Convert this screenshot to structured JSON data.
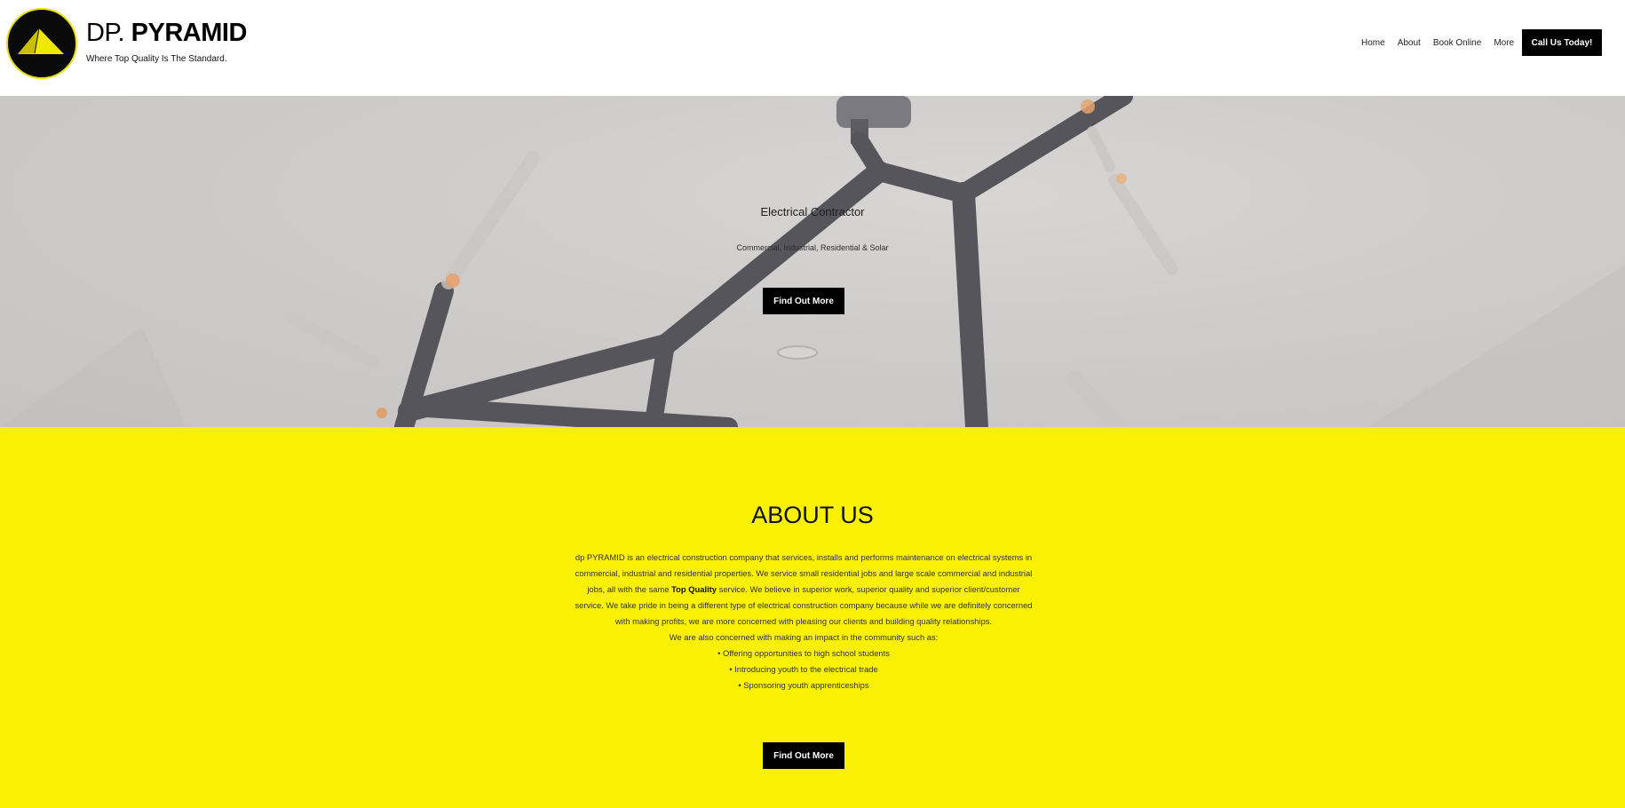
{
  "header": {
    "brand_prefix": "DP.",
    "brand_name": "PYRAMID",
    "tagline": "Where Top Quality Is The Standard.",
    "nav": [
      "Home",
      "About",
      "Book Online",
      "More"
    ],
    "cta_label": "Call Us Today!"
  },
  "hero": {
    "title": "Electrical Contractor",
    "subtitle": "Commercial, Industrial, Residential & Solar",
    "button_label": "Find Out More"
  },
  "about": {
    "title": "ABOUT US",
    "para_before": "dp PYRAMID is an electrical construction company that services, installs and performs maintenance on electrical systems in commercial, industrial and residential properties. We service small residential jobs and large scale commercial and industrial jobs, all with the same ",
    "para_bold": "Top Quality",
    "para_after": " service. We believe in superior work, superior quality and superior client/customer service. We take pride in being a different type of electrical construction company because while we are definitely concerned with making profits, we are more concerned with pleasing our clients and building quality relationships.",
    "community_line": "We are also concerned with making an impact in the community such as:",
    "bullets": [
      "• Offering opportunities to high school students",
      "• Introducing youth to the electrical trade",
      "• Sponsoring youth apprenticeships"
    ],
    "button_label": "Find Out More"
  },
  "colors": {
    "accent_yellow": "#f9f003",
    "button_black": "#000000"
  }
}
